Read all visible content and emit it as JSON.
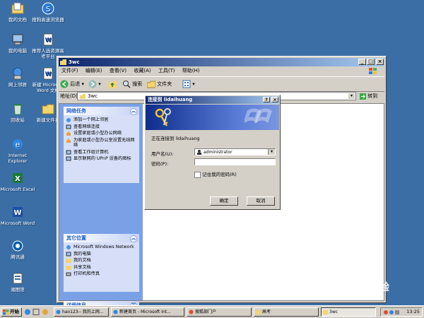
{
  "desktop": {
    "icons": [
      {
        "label": "我的文档"
      },
      {
        "label": "搜狗高速浏览器"
      },
      {
        "label": "我的电脑"
      },
      {
        "label": "推荐人选资源高考平台"
      },
      {
        "label": "网上邻居"
      },
      {
        "label": "新建 Microsoft Word 文档"
      },
      {
        "label": "回收站"
      },
      {
        "label": "新建文件夹"
      },
      {
        "label": "Internet Explorer"
      },
      {
        "label": "Microsoft Excel"
      },
      {
        "label": "Microsoft Word"
      },
      {
        "label": "腾讯通"
      },
      {
        "label": "湘图馆"
      }
    ]
  },
  "window": {
    "title": "3wc",
    "menu": [
      "文件(F)",
      "编辑(E)",
      "查看(V)",
      "收藏(A)",
      "工具(T)",
      "帮助(H)"
    ],
    "toolbar": {
      "back": "后退",
      "search": "搜索",
      "folders": "文件夹"
    },
    "address_label": "地址(D)",
    "address_value": "3wc",
    "go": "转到"
  },
  "network_tasks": {
    "title": "网络任务",
    "items": [
      "添加一个网上邻居",
      "查看网络连接",
      "设置家庭或小型办公网络",
      "为家庭或小型办公室设置无线网络",
      "查看工作组计算机",
      "显示联网的 UPnP 设备的图标"
    ]
  },
  "other_places": {
    "title": "其它位置",
    "items": [
      "Microsoft Windows Network",
      "我的电脑",
      "我的文档",
      "共享文档",
      "打印机和传真"
    ]
  },
  "details": {
    "title": "详细信息"
  },
  "dialog": {
    "title": "连接到 lidaihuang",
    "connecting_text": "正在连接到 lidaihuang",
    "username_label": "用户名(U):",
    "username_value": "administrator",
    "password_label": "密码(P):",
    "password_value": "",
    "remember_label": "记住我的密码(R)",
    "remember_checked": false,
    "ok": "确定",
    "cancel": "取消"
  },
  "taskbar": {
    "start": "开始",
    "tasks": [
      "hao123-- 我的上网...",
      "新建首页 - Microsoft Int...",
      "搜狐部门户",
      "高考",
      "3wc"
    ],
    "clock": "13:25"
  },
  "watermark": "Bai经验",
  "colors": {
    "desktop": "#3a6ea5",
    "title_active": "#0a246a",
    "title_gradient_end": "#a6caf0",
    "task_pane": "#7aa1e6"
  }
}
